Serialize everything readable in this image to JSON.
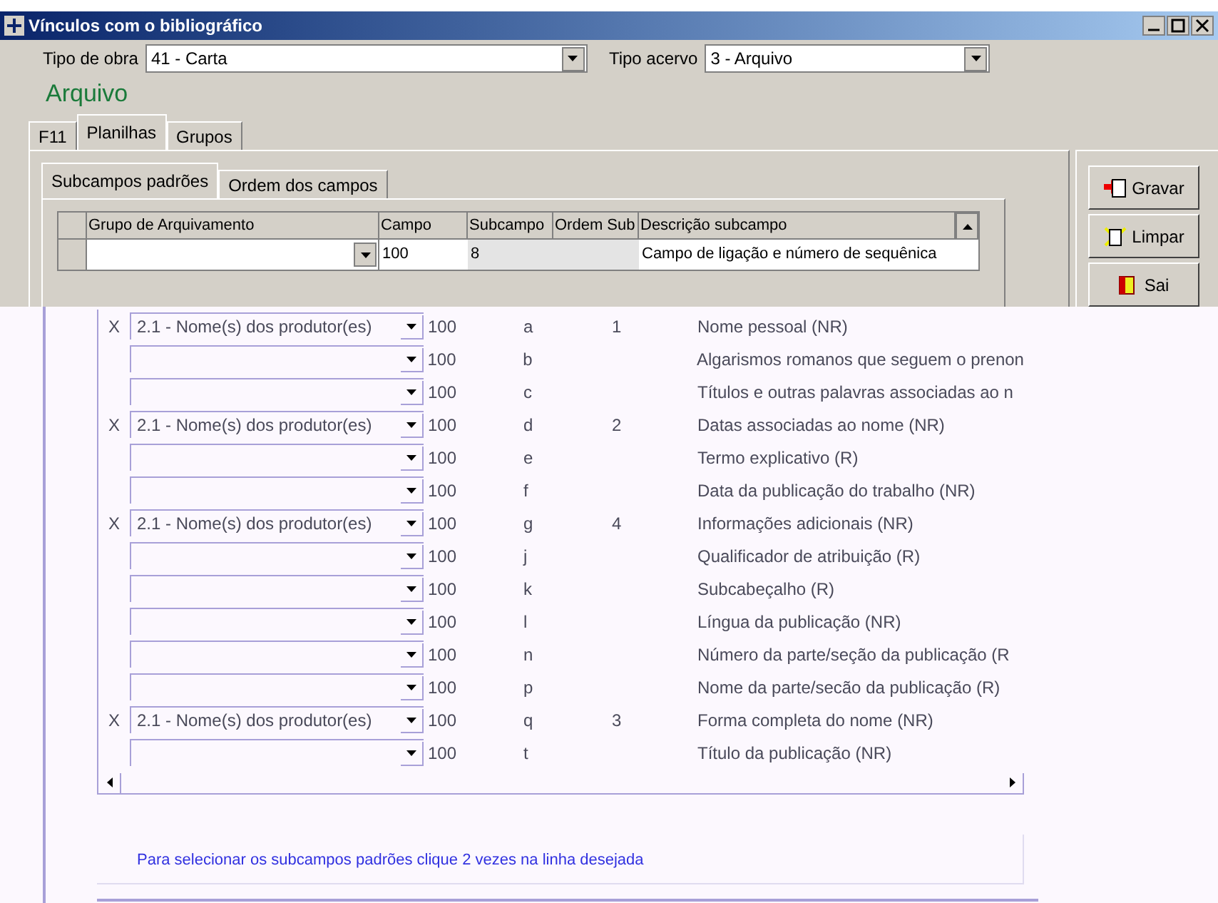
{
  "window": {
    "title": "Vínculos com o bibliográfico"
  },
  "fields": [
    {
      "label": "Tipo de obra",
      "value": "41 - Carta"
    },
    {
      "label": "Tipo acervo",
      "value": "3 - Arquivo"
    }
  ],
  "heading": "Arquivo",
  "tabs": [
    {
      "label": "F11",
      "selected": false
    },
    {
      "label": "Planilhas",
      "selected": true
    },
    {
      "label": "Grupos",
      "selected": false
    }
  ],
  "subtabs": [
    {
      "label": "Subcampos padrões",
      "selected": true
    },
    {
      "label": "Ordem dos campos",
      "selected": false
    }
  ],
  "table": {
    "columns": [
      "Grupo de Arquivamento",
      "Campo",
      "Subcampo",
      "Ordem Sub",
      "Descrição subcampo"
    ],
    "rows": [
      {
        "campo": "100",
        "subcampo": "8",
        "descricao": "Campo de ligação e número de sequênica"
      },
      {
        "mark": "X",
        "grupo": "2.1 - Nome(s) dos produtor(es)",
        "campo": "100",
        "subcampo": "a",
        "ordem": "1",
        "descricao": "Nome pessoal (NR)"
      },
      {
        "campo": "100",
        "subcampo": "b",
        "descricao": "Algarismos romanos que seguem o prenon"
      },
      {
        "campo": "100",
        "subcampo": "c",
        "descricao": "Títulos e outras palavras associadas ao n"
      },
      {
        "mark": "X",
        "grupo": "2.1 - Nome(s) dos produtor(es)",
        "campo": "100",
        "subcampo": "d",
        "ordem": "2",
        "descricao": "Datas associadas ao nome (NR)"
      },
      {
        "campo": "100",
        "subcampo": "e",
        "descricao": "Termo explicativo (R)"
      },
      {
        "campo": "100",
        "subcampo": "f",
        "descricao": "Data da publicação do trabalho (NR)"
      },
      {
        "mark": "X",
        "grupo": "2.1 - Nome(s) dos produtor(es)",
        "campo": "100",
        "subcampo": "g",
        "ordem": "4",
        "descricao": "Informações adicionais (NR)"
      },
      {
        "campo": "100",
        "subcampo": "j",
        "descricao": "Qualificador de atribuição (R)"
      },
      {
        "campo": "100",
        "subcampo": "k",
        "descricao": "Subcabeçalho (R)"
      },
      {
        "campo": "100",
        "subcampo": "l",
        "descricao": "Língua da publicação (NR)"
      },
      {
        "campo": "100",
        "subcampo": "n",
        "descricao": "Número da parte/seção da publicação (R"
      },
      {
        "campo": "100",
        "subcampo": "p",
        "descricao": "Nome da parte/secão da publicação (R)"
      },
      {
        "mark": "X",
        "grupo": "2.1 - Nome(s) dos produtor(es)",
        "campo": "100",
        "subcampo": "q",
        "ordem": "3",
        "descricao": "Forma completa do nome (NR)"
      },
      {
        "campo": "100",
        "subcampo": "t",
        "descricao": "Título da publicação (NR)"
      }
    ]
  },
  "buttons": [
    {
      "kind": "save",
      "label": "Gravar"
    },
    {
      "kind": "clear",
      "label": "Limpar"
    },
    {
      "kind": "exit",
      "label": "Sai"
    }
  ],
  "hint": "Para selecionar os subcampos padrões clique 2 vezes na linha desejada"
}
